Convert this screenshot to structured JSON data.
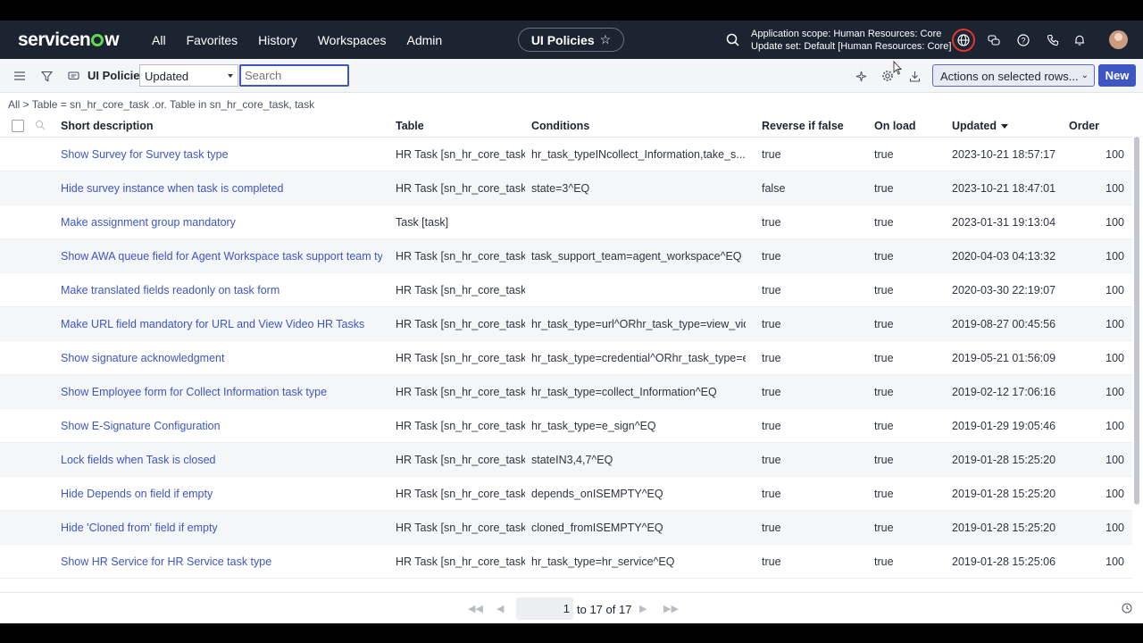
{
  "app": {
    "logo": "servicenow",
    "nav_links": [
      "All",
      "Favorites",
      "History",
      "Workspaces",
      "Admin"
    ],
    "context_pill": "UI Policies",
    "scope_line1": "Application scope: Human Resources: Core",
    "scope_line2": "Update set: Default [Human Resources: Core]"
  },
  "toolbar": {
    "title": "UI Policies",
    "field_select": "Updated",
    "search_placeholder": "Search",
    "actions_label": "Actions on selected rows...",
    "new_label": "New"
  },
  "breadcrumb": "All > Table = sn_hr_core_task .or. Table in sn_hr_core_task, task",
  "table": {
    "columns": [
      "Short description",
      "Table",
      "Conditions",
      "Reverse if false",
      "On load",
      "Updated",
      "Order"
    ],
    "sorted_column": "Updated",
    "rows": [
      {
        "desc": "Show Survey for Survey task type",
        "table": "HR Task [sn_hr_core_task]",
        "cond": "hr_task_typeINcollect_Information,take_s...",
        "rev": "true",
        "load": "true",
        "updated": "2023-10-21 18:57:17",
        "order": "100"
      },
      {
        "desc": "Hide survey instance when task is completed",
        "table": "HR Task [sn_hr_core_task]",
        "cond": "state=3^EQ",
        "rev": "false",
        "load": "true",
        "updated": "2023-10-21 18:47:01",
        "order": "100"
      },
      {
        "desc": "Make assignment group mandatory",
        "table": "Task [task]",
        "cond": "",
        "rev": "true",
        "load": "true",
        "updated": "2023-01-31 19:13:04",
        "order": "100"
      },
      {
        "desc": "Show AWA queue field for Agent Workspace task support team type",
        "table": "HR Task [sn_hr_core_task]",
        "cond": "task_support_team=agent_workspace^EQ",
        "rev": "true",
        "load": "true",
        "updated": "2020-04-03 04:13:32",
        "order": "100"
      },
      {
        "desc": "Make translated fields readonly on task form",
        "table": "HR Task [sn_hr_core_task]",
        "cond": "",
        "rev": "true",
        "load": "true",
        "updated": "2020-03-30 22:19:07",
        "order": "100"
      },
      {
        "desc": "Make URL field mandatory for URL and View Video HR Tasks",
        "table": "HR Task [sn_hr_core_task]",
        "cond": "hr_task_type=url^ORhr_task_type=view_vid...",
        "rev": "true",
        "load": "true",
        "updated": "2019-08-27 00:45:56",
        "order": "100"
      },
      {
        "desc": "Show signature acknowledgment",
        "table": "HR Task [sn_hr_core_task]",
        "cond": "hr_task_type=credential^ORhr_task_type=e...",
        "rev": "true",
        "load": "true",
        "updated": "2019-05-21 01:56:09",
        "order": "100"
      },
      {
        "desc": "Show Employee form for Collect Information task type",
        "table": "HR Task [sn_hr_core_task]",
        "cond": "hr_task_type=collect_Information^EQ",
        "rev": "true",
        "load": "true",
        "updated": "2019-02-12 17:06:16",
        "order": "100"
      },
      {
        "desc": "Show E-Signature Configuration",
        "table": "HR Task [sn_hr_core_task]",
        "cond": "hr_task_type=e_sign^EQ",
        "rev": "true",
        "load": "true",
        "updated": "2019-01-29 19:05:46",
        "order": "100"
      },
      {
        "desc": "Lock fields when Task is closed",
        "table": "HR Task [sn_hr_core_task]",
        "cond": "stateIN3,4,7^EQ",
        "rev": "true",
        "load": "true",
        "updated": "2019-01-28 15:25:20",
        "order": "100"
      },
      {
        "desc": "Hide Depends on field if empty",
        "table": "HR Task [sn_hr_core_task]",
        "cond": "depends_onISEMPTY^EQ",
        "rev": "true",
        "load": "true",
        "updated": "2019-01-28 15:25:20",
        "order": "100"
      },
      {
        "desc": "Hide 'Cloned from' field if empty",
        "table": "HR Task [sn_hr_core_task]",
        "cond": "cloned_fromISEMPTY^EQ",
        "rev": "true",
        "load": "true",
        "updated": "2019-01-28 15:25:20",
        "order": "100"
      },
      {
        "desc": "Show HR Service for HR Service task type",
        "table": "HR Task [sn_hr_core_task]",
        "cond": "hr_task_type=hr_service^EQ",
        "rev": "true",
        "load": "true",
        "updated": "2019-01-28 15:25:06",
        "order": "100"
      }
    ]
  },
  "pagination": {
    "current": "1",
    "range_text": "to 17 of 17"
  },
  "colors": {
    "nav_bg": "#1c2331",
    "accent": "#3d56c4",
    "link": "#3d56c4"
  },
  "icons": [
    "hamburger-icon",
    "filter-icon",
    "chat-icon",
    "search-icon",
    "globe-icon",
    "speech-bubbles-icon",
    "help-icon",
    "phone-icon",
    "bell-icon",
    "sparkle-icon",
    "gear-icon",
    "download-icon",
    "star-icon",
    "clock-icon"
  ]
}
